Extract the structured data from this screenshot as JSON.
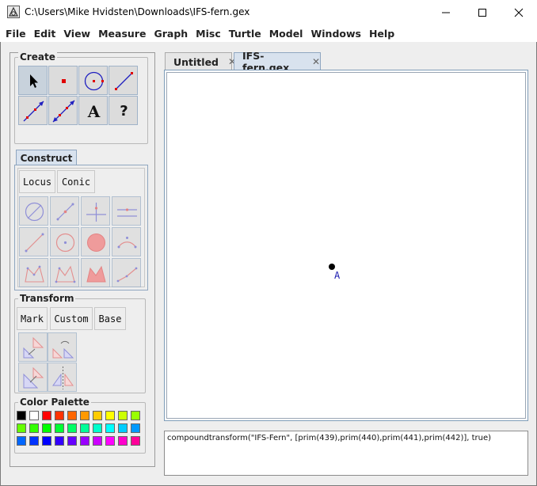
{
  "window": {
    "title": "C:\\Users\\Mike Hvidsten\\Downloads\\IFS-fern.gex",
    "icon": "geometry-explorer-icon"
  },
  "menu": [
    "File",
    "Edit",
    "View",
    "Measure",
    "Graph",
    "Misc",
    "Turtle",
    "Model",
    "Windows",
    "Help"
  ],
  "panels": {
    "create": {
      "title": "Create",
      "text_tool": "A",
      "help_tool": "?"
    },
    "construct": {
      "tab_label": "Construct",
      "locus_label": "Locus",
      "conic_label": "Conic"
    },
    "transform": {
      "title": "Transform",
      "mark_label": "Mark",
      "custom_label": "Custom",
      "base_label": "Base"
    },
    "palette": {
      "title": "Color Palette",
      "colors": [
        "#000000",
        "#ffffff",
        "#ff0000",
        "#ff3300",
        "#ff6600",
        "#ff9900",
        "#ffcc00",
        "#ffff00",
        "#ccff00",
        "#99ff00",
        "#66ff00",
        "#33ff00",
        "#00ff00",
        "#00ff33",
        "#00ff66",
        "#00ff99",
        "#00ffcc",
        "#00ffff",
        "#00ccff",
        "#0099ff",
        "#0066ff",
        "#0033ff",
        "#0000ff",
        "#3300ff",
        "#6600ff",
        "#9900ff",
        "#cc00ff",
        "#ff00ff",
        "#ff00cc",
        "#ff0099"
      ]
    }
  },
  "tabs": [
    {
      "label": "Untitled",
      "active": false
    },
    {
      "label": "IFS-fern.gex",
      "active": true
    }
  ],
  "canvas": {
    "point_label": "A"
  },
  "console": {
    "text": "compoundtransform(\"IFS-Fern\", [prim(439),prim(440),prim(441),prim(442)], true)"
  }
}
